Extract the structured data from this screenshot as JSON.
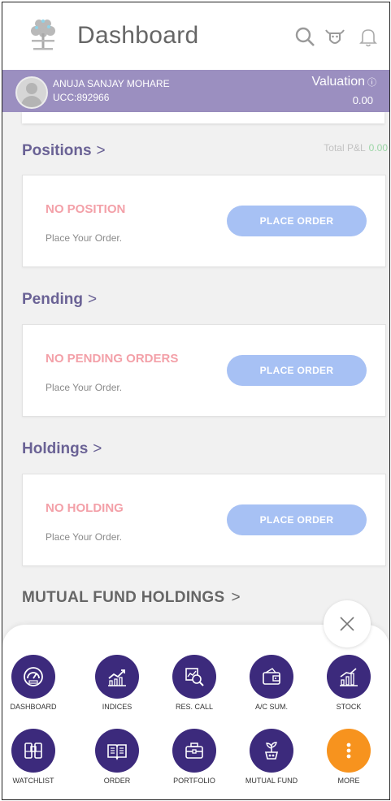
{
  "header": {
    "title": "Dashboard",
    "icons": [
      "tree-logo-icon",
      "search-icon",
      "bull-icon",
      "bell-icon"
    ]
  },
  "user": {
    "name": "ANUJA SANJAY MOHARE",
    "ucc": "UCC:892966",
    "valuation_label": "Valuation",
    "valuation_info": "ⓘ",
    "valuation_value": "0.00"
  },
  "positions": {
    "title": "Positions",
    "chevron": ">",
    "total_pl_label": "Total P&L",
    "total_pl_value": "0.00",
    "status": "NO POSITION",
    "sub": "Place Your Order.",
    "button": "PLACE ORDER"
  },
  "pending": {
    "title": "Pending",
    "chevron": ">",
    "status": "NO PENDING ORDERS",
    "sub": "Place Your Order.",
    "button": "PLACE ORDER"
  },
  "holdings": {
    "title": "Holdings",
    "chevron": ">",
    "status": "NO HOLDING",
    "sub": "Place Your Order.",
    "button": "PLACE ORDER"
  },
  "mutual_fund": {
    "title": "MUTUAL FUND HOLDINGS",
    "chevron": ">"
  },
  "menu": {
    "close_icon": "close-icon",
    "items": [
      {
        "label": "DASHBOARD",
        "icon": "speedometer-icon"
      },
      {
        "label": "INDICES",
        "icon": "trend-chart-icon"
      },
      {
        "label": "RES. CALL",
        "icon": "research-icon"
      },
      {
        "label": "A/C SUM.",
        "icon": "wallet-icon"
      },
      {
        "label": "STOCK",
        "icon": "bar-chart-icon"
      },
      {
        "label": "WATCHLIST",
        "icon": "binoculars-icon"
      },
      {
        "label": "ORDER",
        "icon": "book-icon"
      },
      {
        "label": "PORTFOLIO",
        "icon": "briefcase-icon"
      },
      {
        "label": "MUTUAL FUND",
        "icon": "plant-coins-icon"
      },
      {
        "label": "MORE",
        "icon": "more-icon"
      }
    ],
    "accent_color": "#3c2a7c",
    "more_color": "#f7931e"
  },
  "colors": {
    "header_strip": "#9b8fc0",
    "section_title": "#6a6295",
    "empty_status": "#f3a0a8",
    "button": "#a7c1f4"
  }
}
